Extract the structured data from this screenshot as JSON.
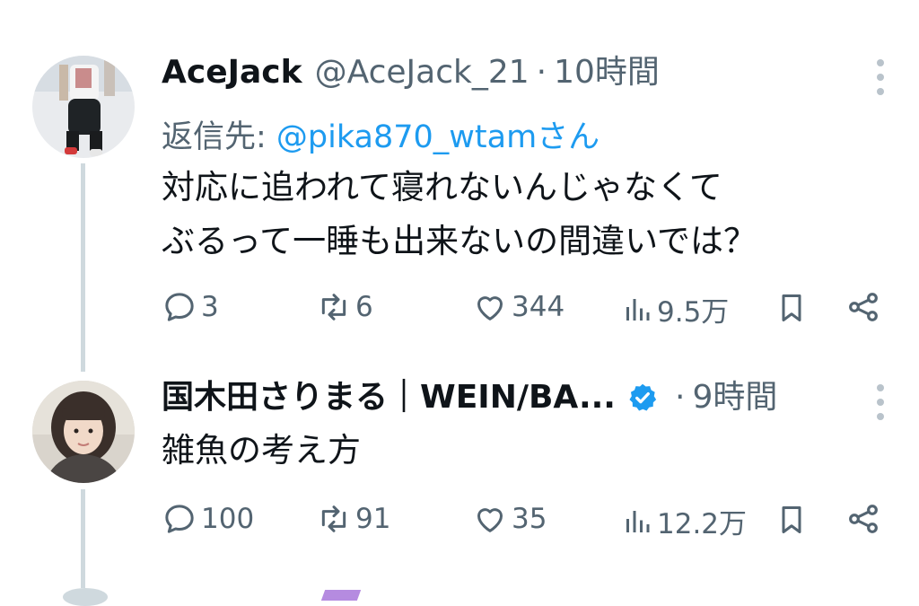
{
  "tweets": [
    {
      "author_name": "AceJack",
      "handle": "@AceJack_21",
      "separator": "·",
      "time": "10時間",
      "reply_prefix": "返信先: ",
      "reply_mention": "@pika870_wtamさん",
      "lines": [
        "対応に追われて寝れないんじゃなくて",
        "ぶるって一睡も出来ないの間違いでは？"
      ],
      "replies": "3",
      "retweets": "6",
      "likes": "344",
      "views": "9.5万",
      "avatar_icon": "person-photo-avatar"
    },
    {
      "author_name": "国木田さりまる｜WEIN/BA...",
      "verified_icon": "verified-badge-icon",
      "separator": "·",
      "time": "9時間",
      "lines": [
        "雑魚の考え方"
      ],
      "replies": "100",
      "retweets": "91",
      "likes": "35",
      "views": "12.2万",
      "avatar_icon": "woman-photo-avatar"
    }
  ],
  "colors": {
    "text": "#0f1419",
    "secondary": "#536471",
    "link": "#1d9bf0",
    "thread_line": "#cfd9de"
  }
}
